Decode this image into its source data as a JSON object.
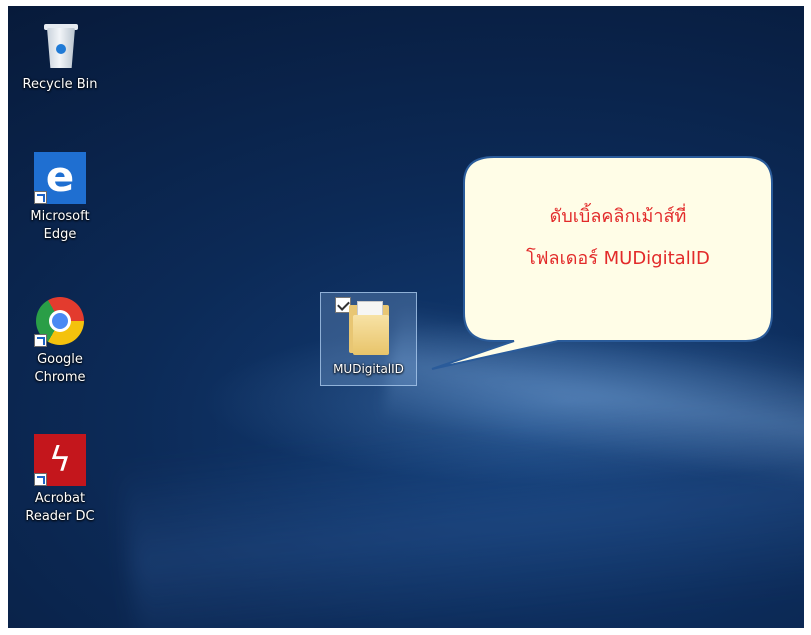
{
  "desktop": {
    "icons": [
      {
        "id": "recycle-bin",
        "label": "Recycle Bin",
        "icon": "recycle-bin-icon",
        "shortcut": false
      },
      {
        "id": "microsoft-edge",
        "label": "Microsoft\nEdge",
        "icon": "edge-icon",
        "shortcut": true
      },
      {
        "id": "google-chrome",
        "label": "Google\nChrome",
        "icon": "chrome-icon",
        "shortcut": true
      },
      {
        "id": "acrobat-reader",
        "label": "Acrobat\nReader DC",
        "icon": "acrobat-icon",
        "shortcut": true
      }
    ],
    "selected_folder": {
      "label": "MUDigitalID",
      "icon": "folder-icon",
      "checked": true
    }
  },
  "callout": {
    "line1": "ดับเบิ้ลคลิกเม้าส์ที่",
    "line2": "โฟลเดอร์ MUDigitalID",
    "text_color": "#e22a2a",
    "fill_color": "#fffde7",
    "border_color": "#2a5b9a"
  },
  "colors": {
    "desktop_background": "#0c2a57",
    "selection_highlight": "#78a0d2"
  }
}
